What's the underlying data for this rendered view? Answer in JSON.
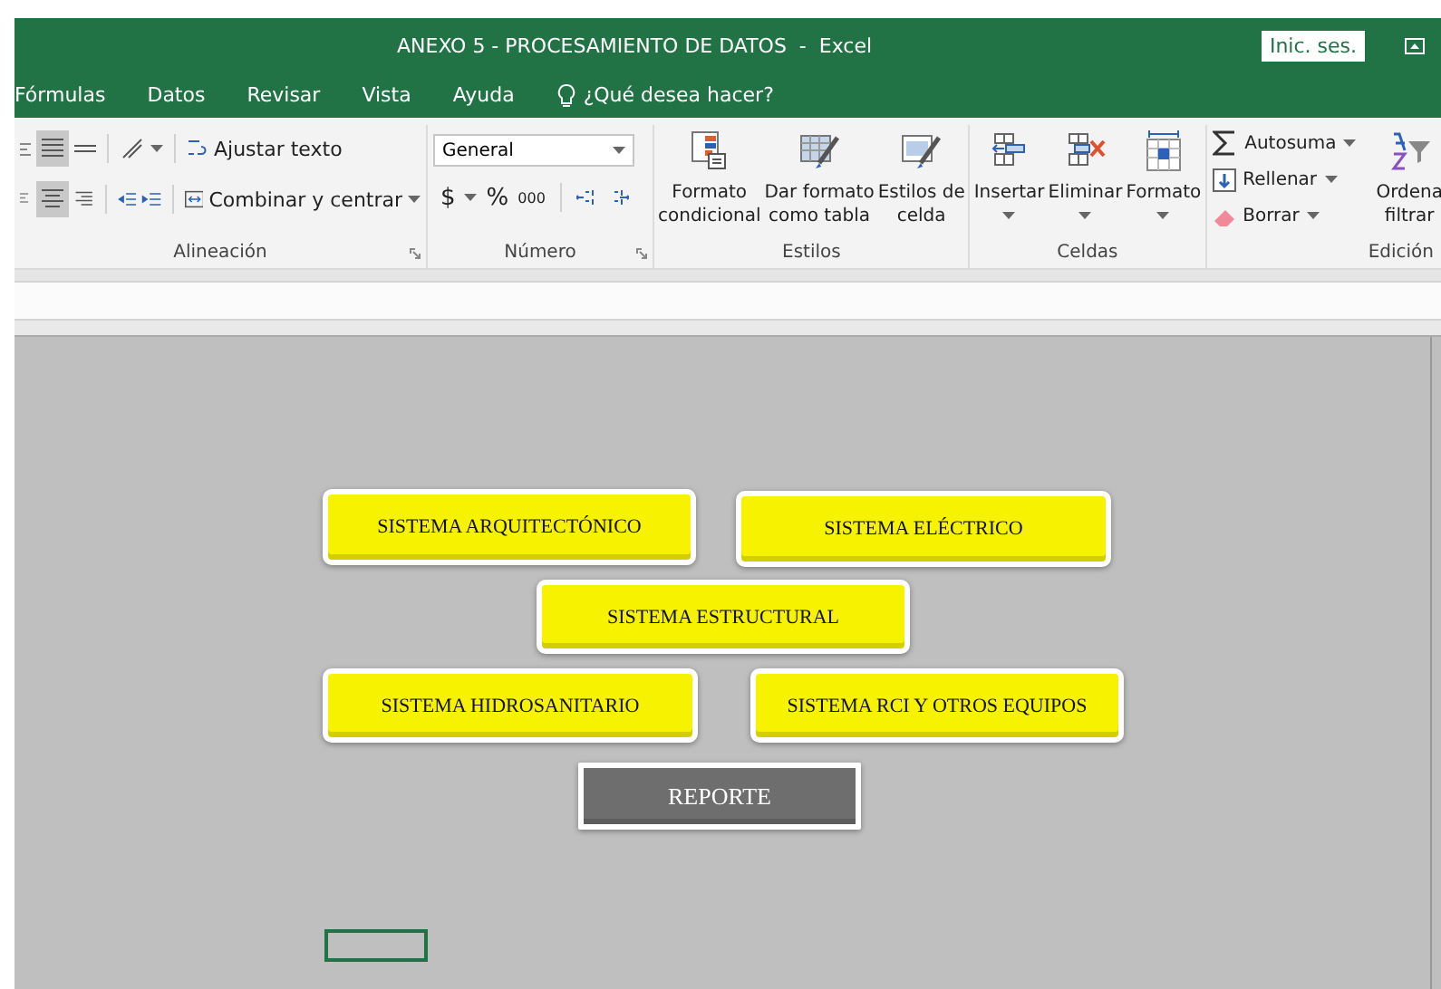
{
  "window": {
    "title": "ANEXO 5 - PROCESAMIENTO DE DATOS  -  Excel",
    "sign_in": "Inic. ses."
  },
  "tabs": [
    {
      "label": "Fórmulas"
    },
    {
      "label": "Datos"
    },
    {
      "label": "Revisar"
    },
    {
      "label": "Vista"
    },
    {
      "label": "Ayuda"
    }
  ],
  "tell_me": "¿Qué desea hacer?",
  "ribbon": {
    "alignment": {
      "wrap_text": "Ajustar texto",
      "merge": "Combinar y centrar",
      "label": "Alineación"
    },
    "number": {
      "format": "General",
      "currency": "$",
      "percent": "%",
      "thousands": "000",
      "label": "Número"
    },
    "styles": {
      "buttons": [
        "Formato\ncondicional",
        "Dar formato\ncomo tabla",
        "Estilos de\ncelda"
      ],
      "label": "Estilos"
    },
    "cells": {
      "buttons": [
        "Insertar",
        "Eliminar",
        "Formato"
      ],
      "label": "Celdas"
    },
    "editing": {
      "items": [
        "Autosuma",
        "Rellenar",
        "Borrar"
      ],
      "sort": "Ordena\nfiltrar",
      "label": "Edición"
    }
  },
  "sheet_buttons": [
    {
      "label": "SISTEMA ARQUITECTÓNICO",
      "kind": "system"
    },
    {
      "label": "SISTEMA ELÉCTRICO",
      "kind": "system"
    },
    {
      "label": "SISTEMA ESTRUCTURAL",
      "kind": "system"
    },
    {
      "label": "SISTEMA HIDROSANITARIO",
      "kind": "system"
    },
    {
      "label": "SISTEMA RCI Y OTROS EQUIPOS",
      "kind": "system"
    },
    {
      "label": "REPORTE",
      "kind": "report"
    }
  ]
}
